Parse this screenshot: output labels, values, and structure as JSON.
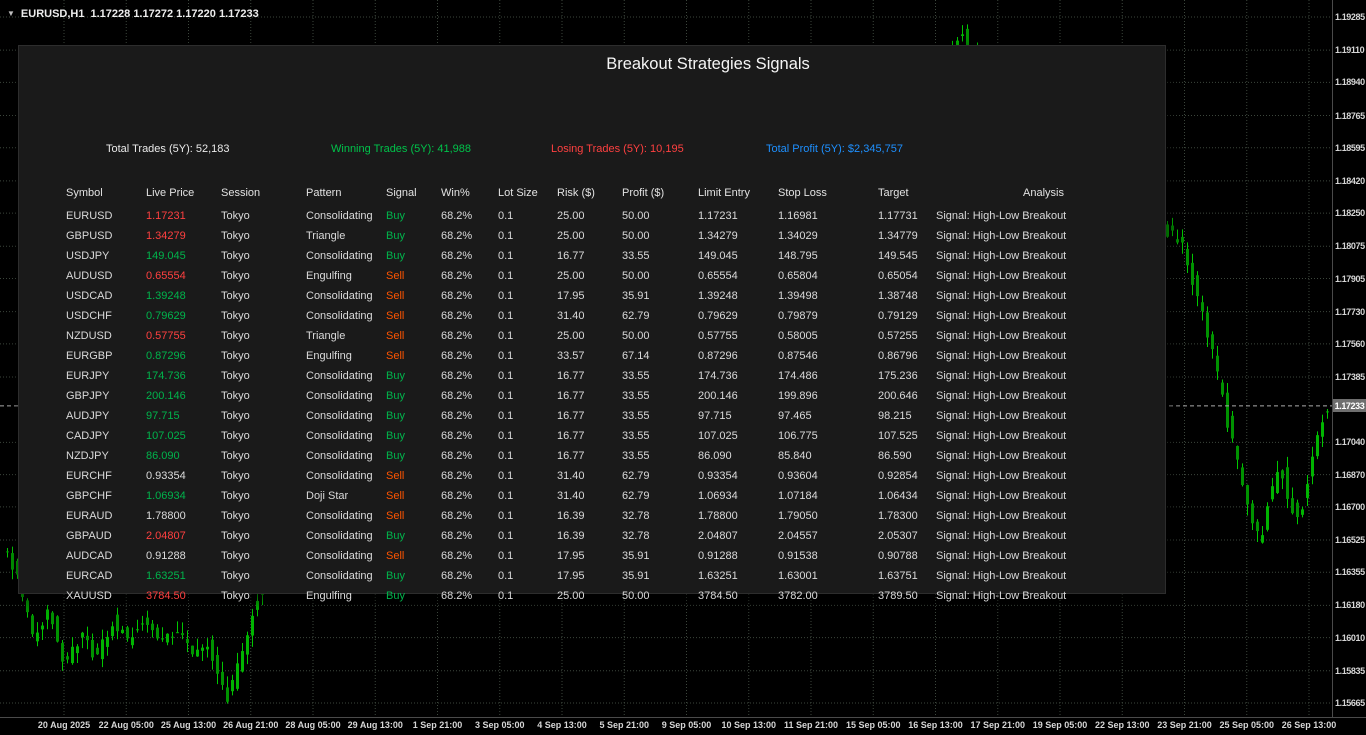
{
  "window": {
    "symbol_period": "EURUSD,H1",
    "ohlc_values": "1.17228 1.17272 1.17220 1.17233"
  },
  "colors": {
    "text": "#DCDCDC",
    "buy": "#00B44C",
    "sell": "#FF5500",
    "price_up": "#00B44C",
    "price_down": "#FF4040",
    "grid": "#3C463C",
    "candle_up": "#00B400",
    "candle_down": "#009200",
    "candle_wick": "#00C800",
    "price_line": "#ABABAB",
    "stat_total": "#EAEAEA",
    "stat_win": "#00C24A",
    "stat_lose": "#FF4040",
    "stat_profit": "#1E90FF"
  },
  "panel": {
    "title": "Breakout Strategies Signals",
    "stats": [
      {
        "label": "Total Trades (5Y): 52,183",
        "color": "#EAEAEA"
      },
      {
        "label": "Winning Trades (5Y): 41,988",
        "color": "#00C24A"
      },
      {
        "label": "Losing Trades (5Y): 10,195",
        "color": "#FF4040"
      },
      {
        "label": "Total Profit (5Y): $2,345,757",
        "color": "#1E90FF"
      }
    ],
    "columns": [
      "Symbol",
      "Live Price",
      "Session",
      "Pattern",
      "Signal",
      "Win%",
      "Lot Size",
      "Risk ($)",
      "Profit ($)",
      "Limit Entry",
      "Stop Loss",
      "Target",
      "Analysis"
    ],
    "rows": [
      {
        "symbol": "EURUSD",
        "price": "1.17231",
        "dir": "down",
        "session": "Tokyo",
        "pattern": "Consolidating",
        "signal": "Buy",
        "win": "68.2%",
        "lot": "0.1",
        "risk": "25.00",
        "profit": "50.00",
        "limit": "1.17231",
        "stop": "1.16981",
        "target": "1.17731",
        "analysis": "Signal: High-Low Breakout"
      },
      {
        "symbol": "GBPUSD",
        "price": "1.34279",
        "dir": "down",
        "session": "Tokyo",
        "pattern": "Triangle",
        "signal": "Buy",
        "win": "68.2%",
        "lot": "0.1",
        "risk": "25.00",
        "profit": "50.00",
        "limit": "1.34279",
        "stop": "1.34029",
        "target": "1.34779",
        "analysis": "Signal: High-Low Breakout"
      },
      {
        "symbol": "USDJPY",
        "price": "149.045",
        "dir": "up",
        "session": "Tokyo",
        "pattern": "Consolidating",
        "signal": "Buy",
        "win": "68.2%",
        "lot": "0.1",
        "risk": "16.77",
        "profit": "33.55",
        "limit": "149.045",
        "stop": "148.795",
        "target": "149.545",
        "analysis": "Signal: High-Low Breakout"
      },
      {
        "symbol": "AUDUSD",
        "price": "0.65554",
        "dir": "down",
        "session": "Tokyo",
        "pattern": "Engulfing",
        "signal": "Sell",
        "win": "68.2%",
        "lot": "0.1",
        "risk": "25.00",
        "profit": "50.00",
        "limit": "0.65554",
        "stop": "0.65804",
        "target": "0.65054",
        "analysis": "Signal: High-Low Breakout"
      },
      {
        "symbol": "USDCAD",
        "price": "1.39248",
        "dir": "up",
        "session": "Tokyo",
        "pattern": "Consolidating",
        "signal": "Sell",
        "win": "68.2%",
        "lot": "0.1",
        "risk": "17.95",
        "profit": "35.91",
        "limit": "1.39248",
        "stop": "1.39498",
        "target": "1.38748",
        "analysis": "Signal: High-Low Breakout"
      },
      {
        "symbol": "USDCHF",
        "price": "0.79629",
        "dir": "up",
        "session": "Tokyo",
        "pattern": "Consolidating",
        "signal": "Sell",
        "win": "68.2%",
        "lot": "0.1",
        "risk": "31.40",
        "profit": "62.79",
        "limit": "0.79629",
        "stop": "0.79879",
        "target": "0.79129",
        "analysis": "Signal: High-Low Breakout"
      },
      {
        "symbol": "NZDUSD",
        "price": "0.57755",
        "dir": "down",
        "session": "Tokyo",
        "pattern": "Triangle",
        "signal": "Sell",
        "win": "68.2%",
        "lot": "0.1",
        "risk": "25.00",
        "profit": "50.00",
        "limit": "0.57755",
        "stop": "0.58005",
        "target": "0.57255",
        "analysis": "Signal: High-Low Breakout"
      },
      {
        "symbol": "EURGBP",
        "price": "0.87296",
        "dir": "up",
        "session": "Tokyo",
        "pattern": "Engulfing",
        "signal": "Sell",
        "win": "68.2%",
        "lot": "0.1",
        "risk": "33.57",
        "profit": "67.14",
        "limit": "0.87296",
        "stop": "0.87546",
        "target": "0.86796",
        "analysis": "Signal: High-Low Breakout"
      },
      {
        "symbol": "EURJPY",
        "price": "174.736",
        "dir": "up",
        "session": "Tokyo",
        "pattern": "Consolidating",
        "signal": "Buy",
        "win": "68.2%",
        "lot": "0.1",
        "risk": "16.77",
        "profit": "33.55",
        "limit": "174.736",
        "stop": "174.486",
        "target": "175.236",
        "analysis": "Signal: High-Low Breakout"
      },
      {
        "symbol": "GBPJPY",
        "price": "200.146",
        "dir": "up",
        "session": "Tokyo",
        "pattern": "Consolidating",
        "signal": "Buy",
        "win": "68.2%",
        "lot": "0.1",
        "risk": "16.77",
        "profit": "33.55",
        "limit": "200.146",
        "stop": "199.896",
        "target": "200.646",
        "analysis": "Signal: High-Low Breakout"
      },
      {
        "symbol": "AUDJPY",
        "price": "97.715",
        "dir": "up",
        "session": "Tokyo",
        "pattern": "Consolidating",
        "signal": "Buy",
        "win": "68.2%",
        "lot": "0.1",
        "risk": "16.77",
        "profit": "33.55",
        "limit": "97.715",
        "stop": "97.465",
        "target": "98.215",
        "analysis": "Signal: High-Low Breakout"
      },
      {
        "symbol": "CADJPY",
        "price": "107.025",
        "dir": "up",
        "session": "Tokyo",
        "pattern": "Consolidating",
        "signal": "Buy",
        "win": "68.2%",
        "lot": "0.1",
        "risk": "16.77",
        "profit": "33.55",
        "limit": "107.025",
        "stop": "106.775",
        "target": "107.525",
        "analysis": "Signal: High-Low Breakout"
      },
      {
        "symbol": "NZDJPY",
        "price": "86.090",
        "dir": "up",
        "session": "Tokyo",
        "pattern": "Consolidating",
        "signal": "Buy",
        "win": "68.2%",
        "lot": "0.1",
        "risk": "16.77",
        "profit": "33.55",
        "limit": "86.090",
        "stop": "85.840",
        "target": "86.590",
        "analysis": "Signal: High-Low Breakout"
      },
      {
        "symbol": "EURCHF",
        "price": "0.93354",
        "dir": "flat",
        "session": "Tokyo",
        "pattern": "Consolidating",
        "signal": "Sell",
        "win": "68.2%",
        "lot": "0.1",
        "risk": "31.40",
        "profit": "62.79",
        "limit": "0.93354",
        "stop": "0.93604",
        "target": "0.92854",
        "analysis": "Signal: High-Low Breakout"
      },
      {
        "symbol": "GBPCHF",
        "price": "1.06934",
        "dir": "up",
        "session": "Tokyo",
        "pattern": "Doji Star",
        "signal": "Sell",
        "win": "68.2%",
        "lot": "0.1",
        "risk": "31.40",
        "profit": "62.79",
        "limit": "1.06934",
        "stop": "1.07184",
        "target": "1.06434",
        "analysis": "Signal: High-Low Breakout"
      },
      {
        "symbol": "EURAUD",
        "price": "1.78800",
        "dir": "flat",
        "session": "Tokyo",
        "pattern": "Consolidating",
        "signal": "Sell",
        "win": "68.2%",
        "lot": "0.1",
        "risk": "16.39",
        "profit": "32.78",
        "limit": "1.78800",
        "stop": "1.79050",
        "target": "1.78300",
        "analysis": "Signal: High-Low Breakout"
      },
      {
        "symbol": "GBPAUD",
        "price": "2.04807",
        "dir": "down",
        "session": "Tokyo",
        "pattern": "Consolidating",
        "signal": "Buy",
        "win": "68.2%",
        "lot": "0.1",
        "risk": "16.39",
        "profit": "32.78",
        "limit": "2.04807",
        "stop": "2.04557",
        "target": "2.05307",
        "analysis": "Signal: High-Low Breakout"
      },
      {
        "symbol": "AUDCAD",
        "price": "0.91288",
        "dir": "flat",
        "session": "Tokyo",
        "pattern": "Consolidating",
        "signal": "Sell",
        "win": "68.2%",
        "lot": "0.1",
        "risk": "17.95",
        "profit": "35.91",
        "limit": "0.91288",
        "stop": "0.91538",
        "target": "0.90788",
        "analysis": "Signal: High-Low Breakout"
      },
      {
        "symbol": "EURCAD",
        "price": "1.63251",
        "dir": "up",
        "session": "Tokyo",
        "pattern": "Consolidating",
        "signal": "Buy",
        "win": "68.2%",
        "lot": "0.1",
        "risk": "17.95",
        "profit": "35.91",
        "limit": "1.63251",
        "stop": "1.63001",
        "target": "1.63751",
        "analysis": "Signal: High-Low Breakout"
      },
      {
        "symbol": "XAUUSD",
        "price": "3784.50",
        "dir": "down",
        "session": "Tokyo",
        "pattern": "Engulfing",
        "signal": "Buy",
        "win": "68.2%",
        "lot": "0.1",
        "risk": "25.00",
        "profit": "50.00",
        "limit": "3784.50",
        "stop": "3782.00",
        "target": "3789.50",
        "analysis": "Signal: High-Low Breakout"
      }
    ]
  },
  "price_axis": {
    "max": "1.19285",
    "min": "1.15665",
    "current": "1.17233",
    "labels": [
      "1.19285",
      "1.19110",
      "1.18940",
      "1.18765",
      "1.18595",
      "1.18420",
      "1.18250",
      "1.18075",
      "1.17905",
      "1.17730",
      "1.17560",
      "1.17385",
      "1.17040",
      "1.16870",
      "1.16700",
      "1.16525",
      "1.16355",
      "1.16180",
      "1.16010",
      "1.15835",
      "1.15665"
    ]
  },
  "time_axis": {
    "labels": [
      "20 Aug 2025",
      "22 Aug 05:00",
      "25 Aug 13:00",
      "26 Aug 21:00",
      "28 Aug 05:00",
      "29 Aug 13:00",
      "1 Sep 21:00",
      "3 Sep 05:00",
      "4 Sep 13:00",
      "5 Sep 21:00",
      "9 Sep 05:00",
      "10 Sep 13:00",
      "11 Sep 21:00",
      "15 Sep 05:00",
      "16 Sep 13:00",
      "17 Sep 21:00",
      "19 Sep 05:00",
      "22 Sep 13:00",
      "23 Sep 21:00",
      "25 Sep 05:00",
      "26 Sep 13:00"
    ]
  },
  "chart": {
    "price_path": [
      [
        6,
        1.165
      ],
      [
        22,
        1.1632
      ],
      [
        36,
        1.1602
      ],
      [
        52,
        1.1616
      ],
      [
        68,
        1.1588
      ],
      [
        84,
        1.1602
      ],
      [
        100,
        1.159
      ],
      [
        116,
        1.161
      ],
      [
        132,
        1.1599
      ],
      [
        148,
        1.1611
      ],
      [
        164,
        1.1597
      ],
      [
        180,
        1.1606
      ],
      [
        196,
        1.1593
      ],
      [
        210,
        1.16
      ],
      [
        222,
        1.1578
      ],
      [
        232,
        1.1569
      ],
      [
        244,
        1.159
      ],
      [
        262,
        1.1625
      ],
      [
        300,
        1.1656
      ],
      [
        360,
        1.1686
      ],
      [
        430,
        1.1705
      ],
      [
        500,
        1.1722
      ],
      [
        570,
        1.174
      ],
      [
        640,
        1.1752
      ],
      [
        710,
        1.1765
      ],
      [
        780,
        1.179
      ],
      [
        850,
        1.1825
      ],
      [
        905,
        1.1862
      ],
      [
        940,
        1.1892
      ],
      [
        965,
        1.1921
      ],
      [
        990,
        1.1893
      ],
      [
        1020,
        1.1868
      ],
      [
        1055,
        1.1842
      ],
      [
        1090,
        1.1812
      ],
      [
        1125,
        1.1798
      ],
      [
        1155,
        1.1808
      ],
      [
        1172,
        1.1816
      ],
      [
        1184,
        1.181
      ],
      [
        1198,
        1.1786
      ],
      [
        1212,
        1.176
      ],
      [
        1226,
        1.1727
      ],
      [
        1240,
        1.1694
      ],
      [
        1254,
        1.1667
      ],
      [
        1263,
        1.1651
      ],
      [
        1274,
        1.1678
      ],
      [
        1284,
        1.1692
      ],
      [
        1294,
        1.167
      ],
      [
        1304,
        1.1667
      ],
      [
        1314,
        1.1692
      ],
      [
        1322,
        1.1712
      ],
      [
        1330,
        1.1723
      ]
    ]
  }
}
